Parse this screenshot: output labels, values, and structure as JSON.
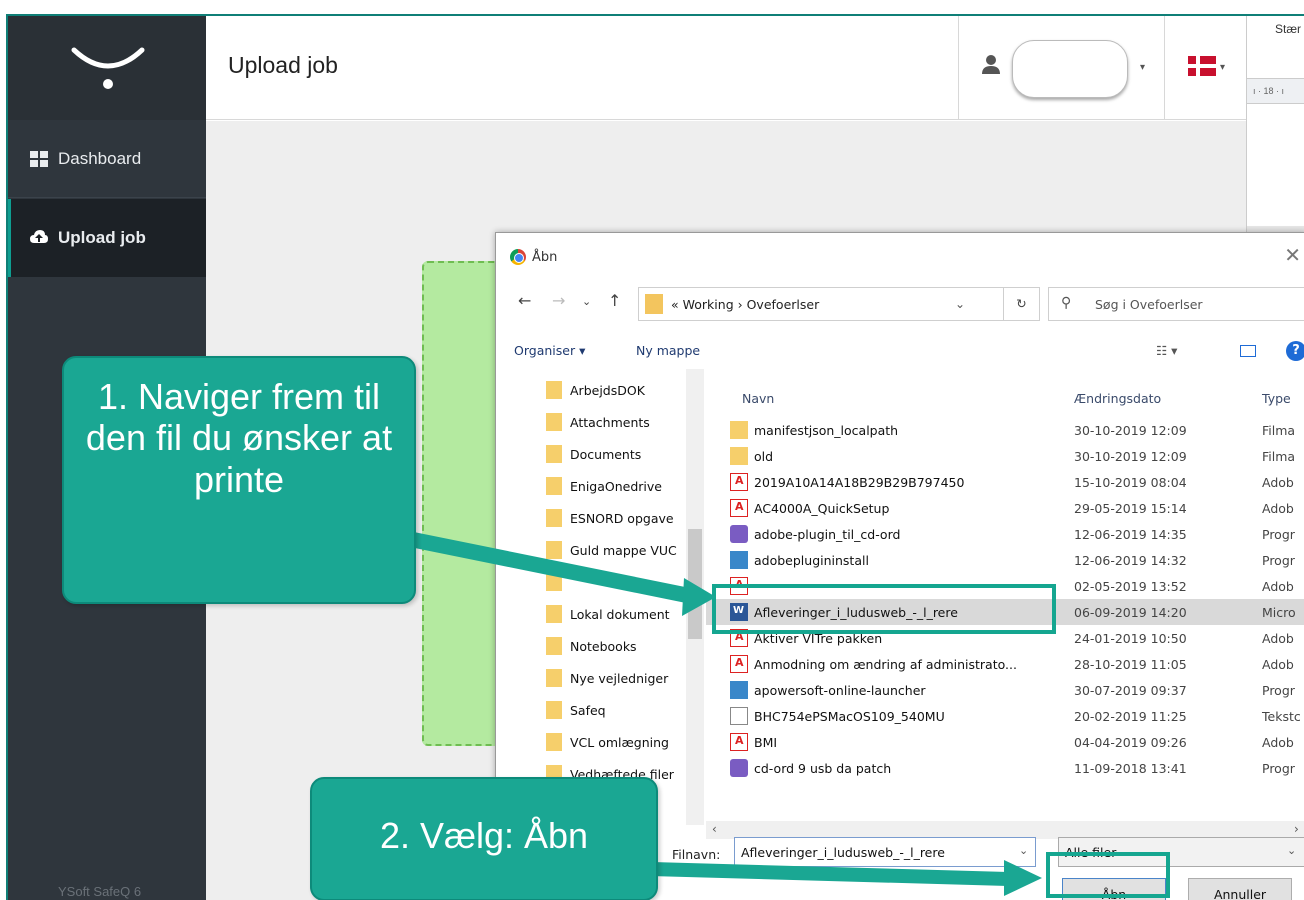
{
  "sidebar": {
    "items": [
      {
        "label": "Dashboard",
        "icon": "grid-icon"
      },
      {
        "label": "Upload job",
        "icon": "cloud-upload-icon"
      }
    ],
    "footer": "YSoft SafeQ 6"
  },
  "header": {
    "title": "Upload job"
  },
  "word_strip": {
    "label": "Stær",
    "ruler": "ı · 18 · ı"
  },
  "dialog": {
    "title": "Åbn",
    "path_prefix": "«",
    "path_1": "Working",
    "path_sep": "›",
    "path_2": "Ovefoerlser",
    "search_placeholder": "Søg i Ovefoerlser",
    "organize_label": "Organiser ▾",
    "new_folder_label": "Ny mappe",
    "view_label": "☷ ▾",
    "help_label": "?",
    "tree_items": [
      "ArbejdsDOK",
      "Attachments",
      "Documents",
      "EnigaOnedrive",
      "ESNORD opgave",
      "Guld mappe VUC",
      "",
      "Lokal dokument",
      "Notebooks",
      "Nye vejledniger",
      "Safeq",
      "VCL omlægning",
      "Vedhæftede filer"
    ],
    "columns": {
      "name": "Navn",
      "date": "Ændringsdato",
      "type": "Type"
    },
    "files": [
      {
        "name": "manifestjson_localpath",
        "date": "30-10-2019 12:09",
        "type": "Filma",
        "icon": "folder-icon"
      },
      {
        "name": "old",
        "date": "30-10-2019 12:09",
        "type": "Filma",
        "icon": "folder-icon"
      },
      {
        "name": "2019A10A14A18B29B29B797450",
        "date": "15-10-2019 08:04",
        "type": "Adob",
        "icon": "pdf-icon"
      },
      {
        "name": "AC4000A_QuickSetup",
        "date": "29-05-2019 15:14",
        "type": "Adob",
        "icon": "pdf-icon"
      },
      {
        "name": "adobe-plugin_til_cd-ord",
        "date": "12-06-2019 14:35",
        "type": "Progr",
        "icon": "app-icon"
      },
      {
        "name": "adobeplugininstall",
        "date": "12-06-2019 14:32",
        "type": "Progr",
        "icon": "installer-icon"
      },
      {
        "name": "",
        "date": "02-05-2019 13:52",
        "type": "Adob",
        "icon": "pdf-icon"
      },
      {
        "name": "Afleveringer_i_ludusweb_-_l_rere",
        "date": "06-09-2019 14:20",
        "type": "Micro",
        "icon": "word-icon"
      },
      {
        "name": "Aktiver VITre pakken",
        "date": "24-01-2019 10:50",
        "type": "Adob",
        "icon": "pdf-icon"
      },
      {
        "name": "Anmodning om ændring af administrato...",
        "date": "28-10-2019 11:05",
        "type": "Adob",
        "icon": "pdf-icon"
      },
      {
        "name": "apowersoft-online-launcher",
        "date": "30-07-2019 09:37",
        "type": "Progr",
        "icon": "installer-icon"
      },
      {
        "name": "BHC754ePSMacOS109_540MU",
        "date": "20-02-2019 11:25",
        "type": "Tekstc",
        "icon": "text-file-icon"
      },
      {
        "name": "BMI",
        "date": "04-04-2019 09:26",
        "type": "Adob",
        "icon": "pdf-icon"
      },
      {
        "name": "cd-ord 9 usb da patch",
        "date": "11-09-2018 13:41",
        "type": "Progr",
        "icon": "app-icon"
      }
    ],
    "filename_label": "Filnavn:",
    "filename_value": "Afleveringer_i_ludusweb_-_l_rere",
    "filetype_value": "Alle filer",
    "open_button": "Åbn",
    "cancel_button": "Annuller"
  },
  "callouts": {
    "step1": "1. Naviger frem til den fil du ønsker at printe",
    "step2": "2. Vælg: Åbn"
  },
  "colors": {
    "accent": "#1aa793",
    "sidebar": "#2f363d",
    "dropzone": "#b4eaa0"
  }
}
